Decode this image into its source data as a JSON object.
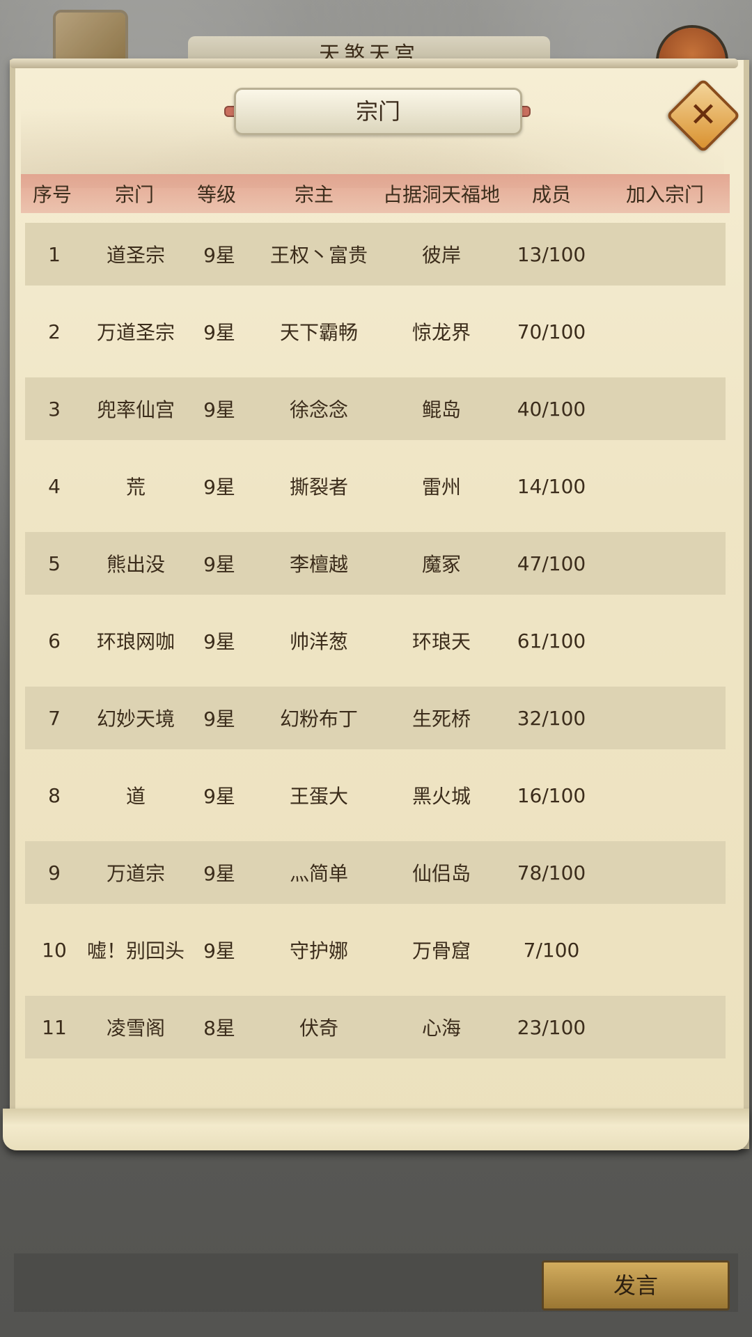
{
  "background": {
    "title": "天煞天宫"
  },
  "panel": {
    "title": "宗门",
    "close_icon": "close-x-icon"
  },
  "columns": [
    "序号",
    "宗门",
    "等级",
    "宗主",
    "占据洞天福地",
    "成员",
    "加入宗门"
  ],
  "rows": [
    {
      "rank": "1",
      "sect": "道圣宗",
      "level": "9星",
      "leader": "王权丶富贵",
      "territory": "彼岸",
      "members": "13/100"
    },
    {
      "rank": "2",
      "sect": "万道圣宗",
      "level": "9星",
      "leader": "天下霸畅",
      "territory": "惊龙界",
      "members": "70/100"
    },
    {
      "rank": "3",
      "sect": "兜率仙宫",
      "level": "9星",
      "leader": "徐念念",
      "territory": "鲲岛",
      "members": "40/100"
    },
    {
      "rank": "4",
      "sect": "荒",
      "level": "9星",
      "leader": "撕裂者",
      "territory": "雷州",
      "members": "14/100"
    },
    {
      "rank": "5",
      "sect": "熊出没",
      "level": "9星",
      "leader": "李檀越",
      "territory": "魔冢",
      "members": "47/100"
    },
    {
      "rank": "6",
      "sect": "环琅网咖",
      "level": "9星",
      "leader": "帅洋葱",
      "territory": "环琅天",
      "members": "61/100"
    },
    {
      "rank": "7",
      "sect": "幻妙天境",
      "level": "9星",
      "leader": "幻粉布丁",
      "territory": "生死桥",
      "members": "32/100"
    },
    {
      "rank": "8",
      "sect": "道",
      "level": "9星",
      "leader": "王蛋大",
      "territory": "黑火城",
      "members": "16/100"
    },
    {
      "rank": "9",
      "sect": "万道宗",
      "level": "9星",
      "leader": "灬简单",
      "territory": "仙侣岛",
      "members": "78/100"
    },
    {
      "rank": "10",
      "sect": "嘘！别回头",
      "level": "9星",
      "leader": "守护娜",
      "territory": "万骨窟",
      "members": "7/100"
    },
    {
      "rank": "11",
      "sect": "凌雪阁",
      "level": "8星",
      "leader": "伏奇",
      "territory": "心海",
      "members": "23/100"
    }
  ],
  "bottom": {
    "speak_label": "发言"
  }
}
